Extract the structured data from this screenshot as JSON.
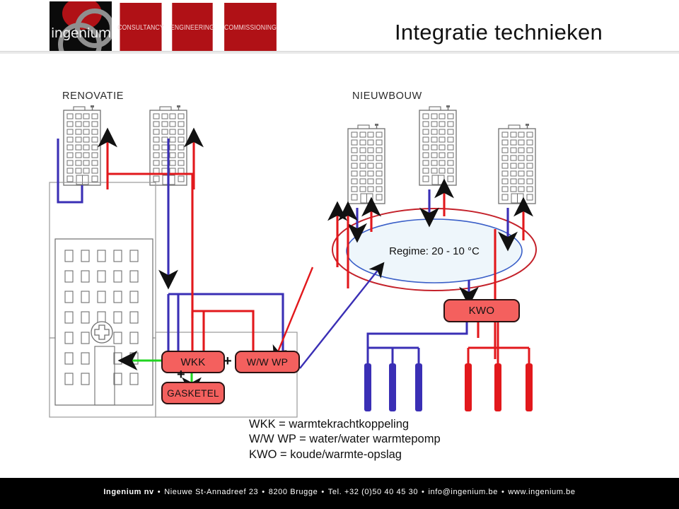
{
  "header": {
    "logo_word": "ingenium",
    "services": [
      "CONSULTANCY",
      "ENGINEERING",
      "COMMISSIONING"
    ],
    "title": "Integratie technieken"
  },
  "diagram": {
    "section_labels": {
      "left": "RENOVATIE",
      "right": "NIEUWBOUW"
    },
    "ring_label": "Regime: 20 - 10 °C",
    "boxes": {
      "wkk": "WKK",
      "gasketel": "GASKETEL",
      "wwwp": "W/W WP",
      "kwo": "KWO"
    },
    "plus_signs": [
      "+",
      "+"
    ],
    "colors": {
      "hot_pipe": "#e2181c",
      "cold_pipe": "#3a2fb5",
      "green_pipe": "#21d421",
      "box_fill": "#f4605e",
      "box_border": "#2b1212",
      "ring_outer": "#c4212a",
      "ring_inner": "#3a5fc8",
      "ring_fill": "#eef6fb",
      "building_outline": "#6f6f6f",
      "boundary": "#9a9a9a"
    },
    "buildings_renovatie": 2,
    "buildings_nieuwbouw": 3,
    "hospital_symbol": "cross",
    "wells_cold": 3,
    "wells_warm": 3
  },
  "legend": [
    "WKK = warmtekrachtkoppeling",
    "W/W WP = water/water warmtepomp",
    "KWO = koude/warmte-opslag"
  ],
  "footer": {
    "company": "Ingenium nv",
    "address": "Nieuwe St-Annadreef  23",
    "city": "8200 Brugge",
    "phone": "Tel. +32 (0)50 40 45 30",
    "email": "info@ingenium.be",
    "web": "www.ingenium.be",
    "separator": "•"
  }
}
